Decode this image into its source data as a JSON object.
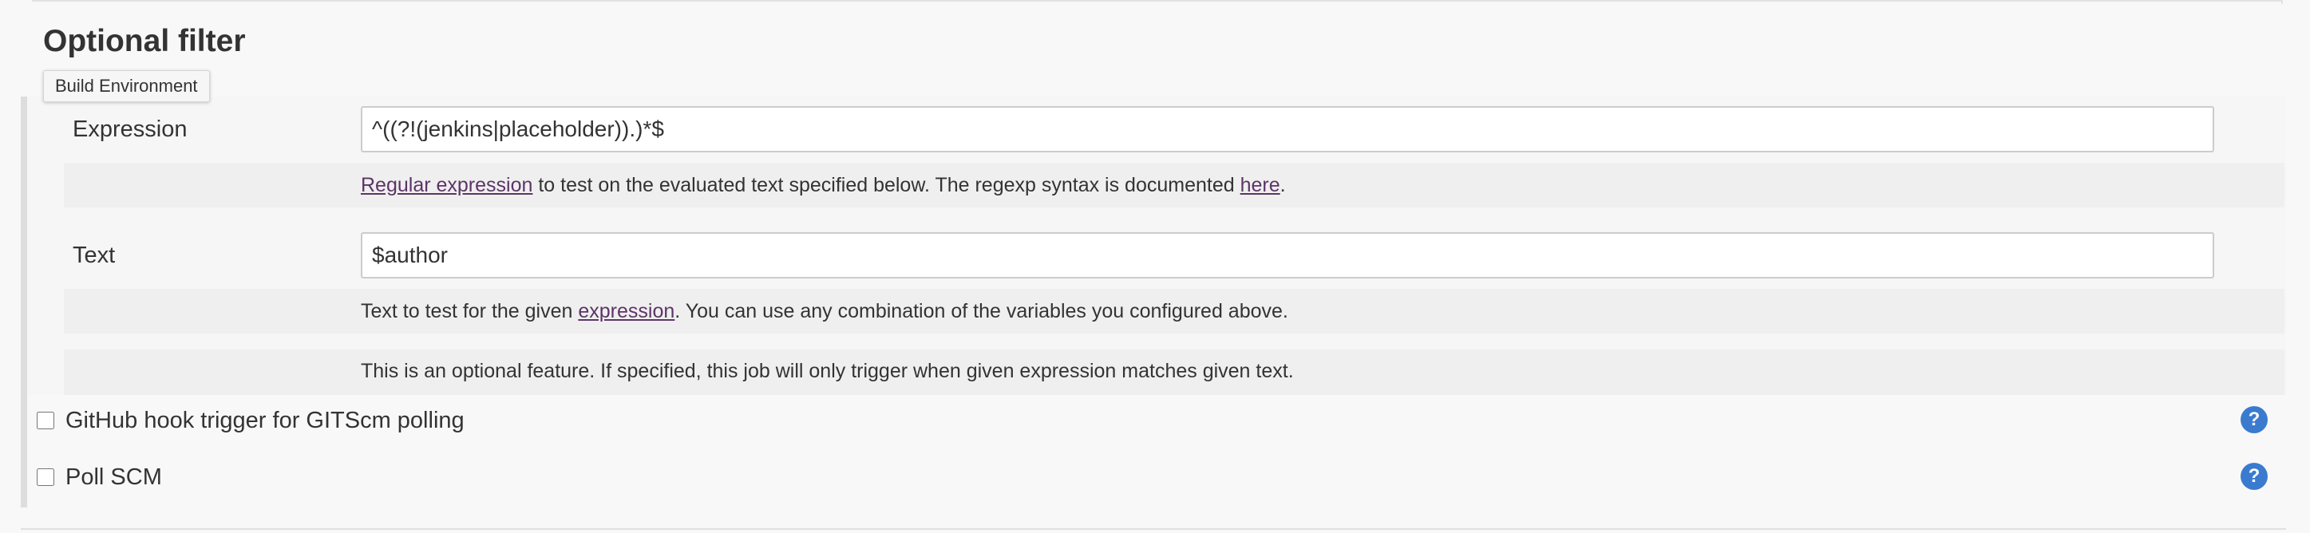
{
  "section": {
    "title": "Optional filter"
  },
  "tooltip": {
    "text": "Build Environment"
  },
  "expression": {
    "label": "Expression",
    "value": "^((?!(jenkins|placeholder)).)*$",
    "help_link": "Regular expression",
    "help_middle": " to test on the evaluated text specified below. The regexp syntax is documented ",
    "help_here": "here",
    "help_end": "."
  },
  "text": {
    "label": "Text",
    "value": "$author",
    "help_start": "Text to test for the given ",
    "help_link": "expression",
    "help_end": ". You can use any combination of the variables you configured above."
  },
  "optional_note": "This is an optional feature. If specified, this job will only trigger when given expression matches given text.",
  "triggers": [
    {
      "label": "GitHub hook trigger for GITScm polling",
      "checked": false,
      "help": "?"
    },
    {
      "label": "Poll SCM",
      "checked": false,
      "help": "?"
    }
  ],
  "colors": {
    "help_icon": "#3a7bd0",
    "link": "#5c3566",
    "panel": "#f6f6f6"
  }
}
